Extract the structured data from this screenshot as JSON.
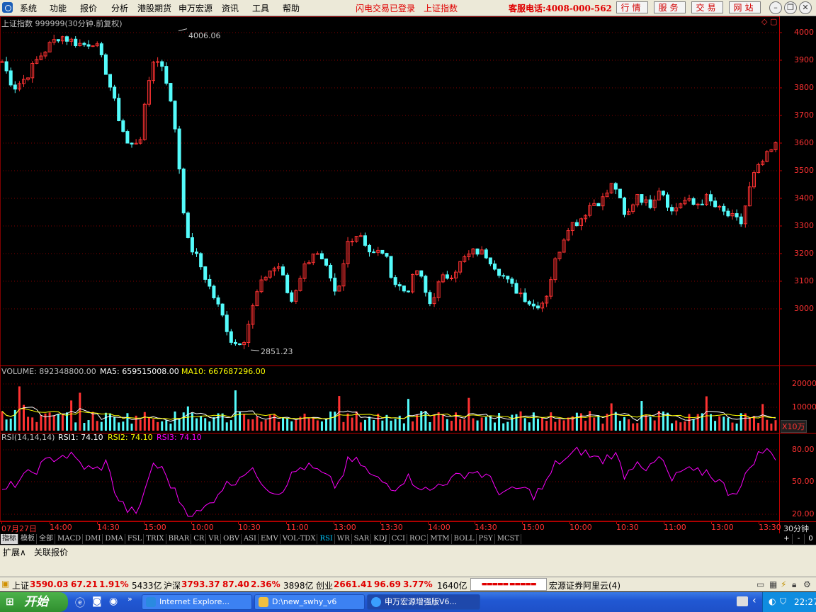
{
  "menu": {
    "items": [
      "系统",
      "功能",
      "报价",
      "分析",
      "港股期货",
      "申万宏源",
      "资讯",
      "工具",
      "帮助"
    ],
    "status_flash": "闪电交易已登录",
    "status_index": "上证指数",
    "hotline": "客服电话:4008-000-562",
    "buttons": [
      "行情",
      "服务",
      "交易",
      "网站"
    ]
  },
  "chart": {
    "title": "上证指数  999999(30分钟.前复权)",
    "high_label": "4006.06",
    "low_label": "2851.23",
    "price_ticks": [
      "4000",
      "3900",
      "3800",
      "3700",
      "3600",
      "3500",
      "3400",
      "3300",
      "3200",
      "3100",
      "3000"
    ],
    "volume_label": "VOLUME: 892348800.00",
    "ma5_label": "MA5: 659515008.00",
    "ma10_label": "MA10: 667687296.00",
    "volume_ticks": [
      "20000",
      "10000"
    ],
    "volume_unit": "X10万",
    "rsi_label": "RSI(14,14,14)",
    "rsi1_label": "RSI1: 74.10",
    "rsi2_label": "RSI2: 74.10",
    "rsi3_label": "RSI3: 74.10",
    "rsi_ticks": [
      "80.00",
      "50.00",
      "20.00"
    ],
    "time_labels": [
      "07月27日",
      "14:00",
      "14:30",
      "15:00",
      "10:00",
      "10:30",
      "11:00",
      "13:00",
      "13:30",
      "14:00",
      "14:30",
      "15:00",
      "10:00",
      "10:30",
      "11:00",
      "13:00",
      "13:30"
    ],
    "period_label": "30分钟",
    "colors": {
      "up": "#ff3232",
      "down": "#54fcfc",
      "ma5": "#ffffff",
      "ma10": "#ffff00",
      "rsi": "#ff00ff",
      "grid": "#800000"
    }
  },
  "chart_data": {
    "type": "line",
    "title": "上证指数 999999(30分钟.前复权)",
    "xlabel": "",
    "ylabel": "",
    "ylim": [
      2851.23,
      4006.06
    ],
    "x": [
      "07月27日",
      "14:00",
      "14:30",
      "15:00",
      "10:00",
      "10:30",
      "11:00",
      "13:00",
      "13:30",
      "14:00",
      "14:30",
      "15:00",
      "10:00",
      "10:30",
      "11:00",
      "13:00",
      "13:30"
    ],
    "series": [
      {
        "name": "",
        "values": [
          3895,
          3800,
          3835,
          3900,
          3950,
          3990,
          3970,
          3955,
          3970,
          3860,
          3705,
          3580,
          3625,
          3905,
          3880,
          3650,
          3250,
          3175,
          3075,
          2982,
          2870,
          2895,
          3050,
          3135,
          3155,
          3020,
          3140,
          3210,
          3150,
          3030,
          3255,
          3275,
          3195,
          3210,
          3095,
          3060,
          3145,
          3015,
          3105,
          3130,
          3180,
          3210,
          3195,
          3140,
          3085,
          3055,
          3010,
          3030,
          3185,
          3300,
          3320,
          3380,
          3395,
          3460,
          3320,
          3420,
          3370,
          3445,
          3350,
          3395,
          3375,
          3400,
          3360,
          3335,
          3310,
          3475,
          3540,
          3590
        ]
      },
      {
        "name": "RSI1",
        "values": [
          40,
          48,
          55,
          62,
          70,
          75,
          74,
          65,
          60,
          68,
          35,
          22,
          25,
          68,
          60,
          40,
          22,
          20,
          30,
          45,
          50,
          60,
          58,
          45,
          40,
          55,
          65,
          62,
          55,
          45,
          70,
          68,
          55,
          50,
          45,
          55,
          48,
          40,
          50,
          52,
          58,
          60,
          55,
          42,
          40,
          45,
          38,
          46,
          68,
          72,
          80,
          74,
          70,
          78,
          55,
          72,
          60,
          74,
          50,
          62,
          58,
          60,
          52,
          40,
          45,
          70,
          80,
          74
        ]
      },
      {
        "name": "RSI2",
        "values": [
          40,
          48,
          55,
          62,
          70,
          75,
          74,
          65,
          60,
          68,
          35,
          22,
          25,
          68,
          60,
          40,
          22,
          20,
          30,
          45,
          50,
          60,
          58,
          45,
          40,
          55,
          65,
          62,
          55,
          45,
          70,
          68,
          55,
          50,
          45,
          55,
          48,
          40,
          50,
          52,
          58,
          60,
          55,
          42,
          40,
          45,
          38,
          46,
          68,
          72,
          80,
          74,
          70,
          78,
          55,
          72,
          60,
          74,
          50,
          62,
          58,
          60,
          52,
          40,
          45,
          70,
          80,
          74
        ]
      },
      {
        "name": "RSI3",
        "values": [
          40,
          48,
          55,
          62,
          70,
          75,
          74,
          65,
          60,
          68,
          35,
          22,
          25,
          68,
          60,
          40,
          22,
          20,
          30,
          45,
          50,
          60,
          58,
          45,
          40,
          55,
          65,
          62,
          55,
          45,
          70,
          68,
          55,
          50,
          45,
          55,
          48,
          40,
          50,
          52,
          58,
          60,
          55,
          42,
          40,
          45,
          38,
          46,
          68,
          72,
          80,
          74,
          70,
          78,
          55,
          72,
          60,
          74,
          50,
          62,
          58,
          60,
          52,
          40,
          45,
          70,
          80,
          74
        ]
      }
    ]
  },
  "tabs": {
    "left": [
      "指标",
      "模板",
      "全部"
    ],
    "indicators": [
      "MACD",
      "DMI",
      "DMA",
      "FSL",
      "TRIX",
      "BRAR",
      "CR",
      "VR",
      "OBV",
      "ASI",
      "EMV",
      "VOL-TDX",
      "RSI",
      "WR",
      "SAR",
      "KDJ",
      "CCI",
      "ROC",
      "MTM",
      "BOLL",
      "PSY",
      "MCST"
    ],
    "selected": "RSI",
    "right": [
      "+",
      "-",
      "0"
    ]
  },
  "ext": {
    "expand": "扩展∧",
    "related": "关联报价"
  },
  "status": {
    "sh_name": "上证",
    "sh_price": "3590.03",
    "sh_chg": "67.21",
    "sh_pct": "1.91%",
    "sh_amt": "5433亿",
    "hs_name": "沪深",
    "hs_price": "3793.37",
    "hs_chg": "87.40",
    "hs_pct": "2.36%",
    "hs_amt": "3898亿",
    "cy_name": "创业",
    "cy_price": "2661.41",
    "cy_chg": "96.69",
    "cy_pct": "3.77%",
    "cy_amt": "1640亿",
    "broker": "宏源证券阿里云(4)"
  },
  "taskbar": {
    "start": "开始",
    "tasks": [
      "Internet Explore...",
      "D:\\new_swhy_v6",
      "申万宏源增强版V6..."
    ],
    "time": "22:27"
  }
}
